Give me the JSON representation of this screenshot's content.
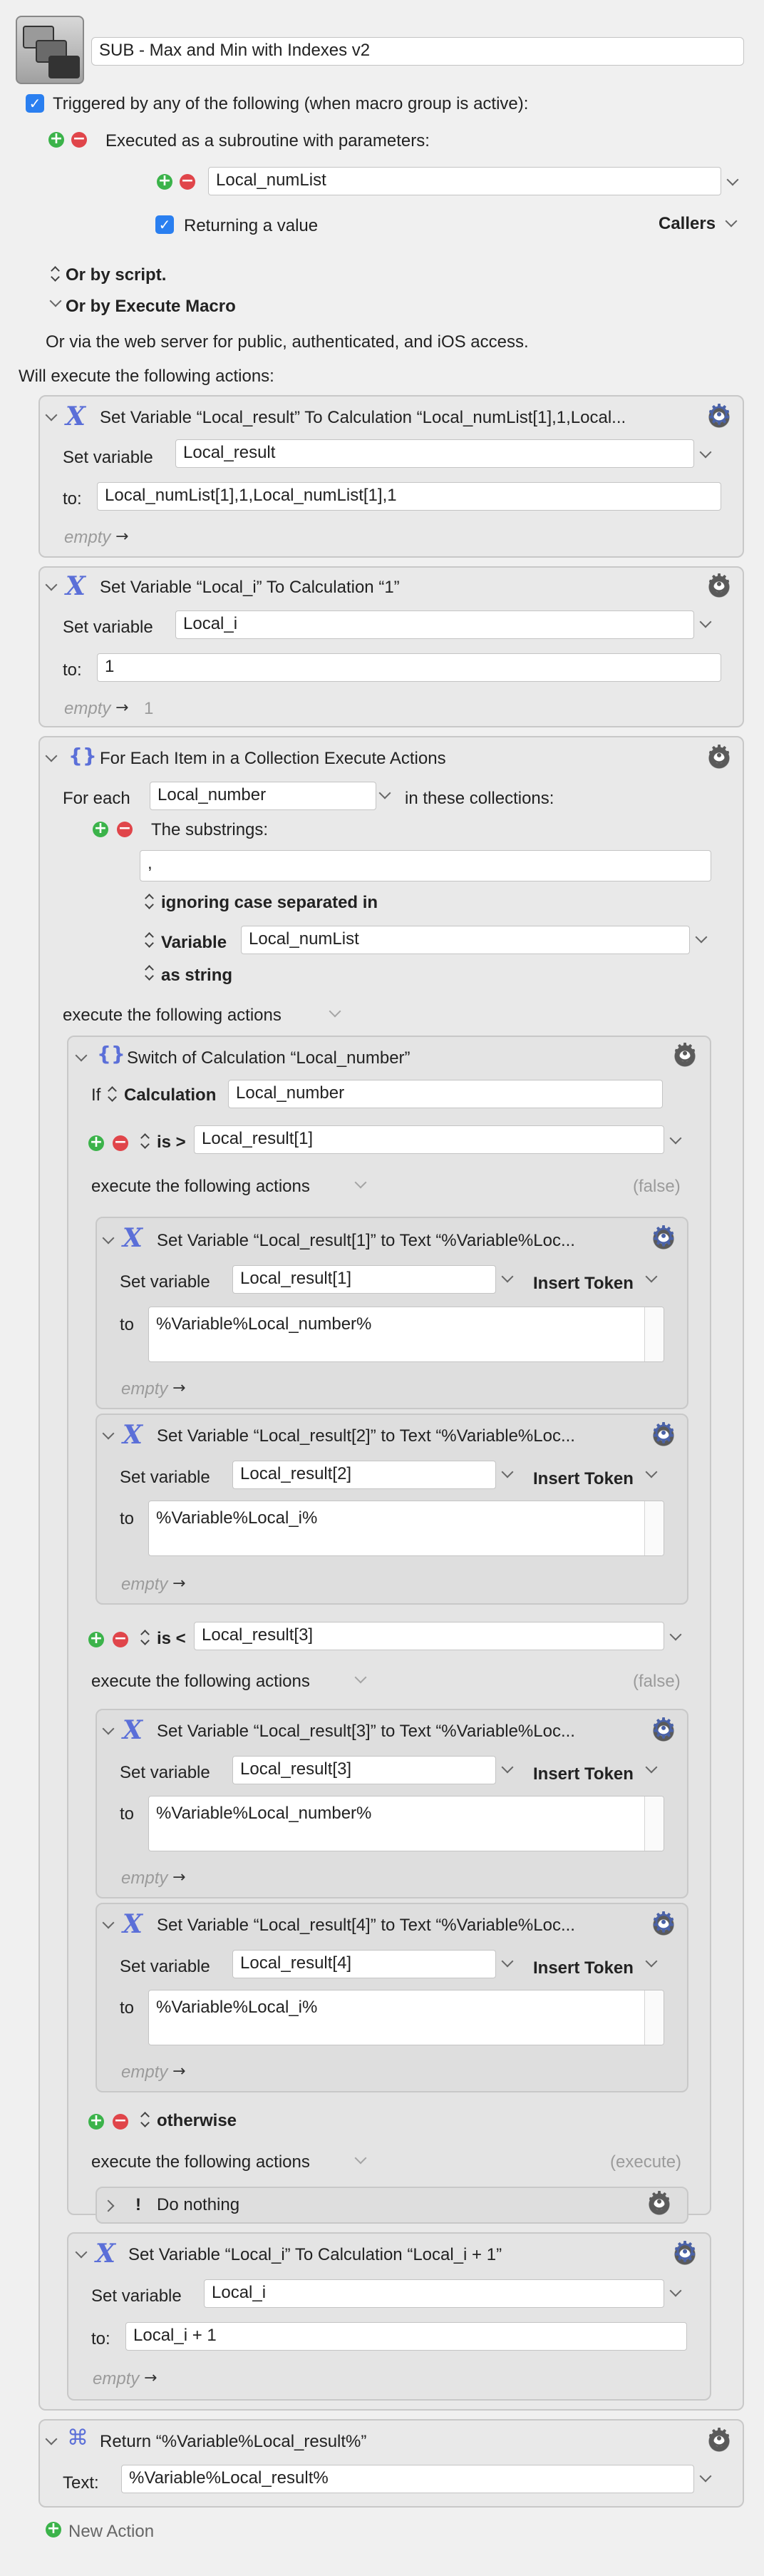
{
  "macro": {
    "name": "SUB - Max and Min with Indexes v2",
    "trigger_label": "Triggered by any of the following (when macro group is active):",
    "subroutine_label": "Executed as a subroutine with parameters:",
    "param_value": "Local_numList",
    "returning_label": "Returning a value",
    "callers_label": "Callers",
    "by_script": "Or by script.",
    "by_execute_macro": "Or by Execute Macro",
    "web_server": "Or via the web server for public, authenticated, and iOS access.",
    "will_execute": "Will execute the following actions:",
    "new_action": "New Action"
  },
  "a1": {
    "title": "Set Variable “Local_result” To Calculation “Local_numList[1],1,Local...",
    "set_label": "Set variable",
    "var": "Local_result",
    "to_label": "to:",
    "value": "Local_numList[1],1,Local_numList[1],1",
    "empty": "empty",
    "arrow": "→",
    "result": ""
  },
  "a2": {
    "title": "Set Variable “Local_i” To Calculation “1”",
    "set_label": "Set variable",
    "var": "Local_i",
    "to_label": "to:",
    "value": "1",
    "empty": "empty",
    "arrow": "→",
    "result": "1"
  },
  "foreach": {
    "title": "For Each Item in a Collection Execute Actions",
    "for_each": "For each",
    "var": "Local_number",
    "in_collections": "in these collections:",
    "substrings": "The substrings:",
    "separator": ",",
    "ignoring": "ignoring case separated in",
    "variable_label": "Variable",
    "variable_value": "Local_numList",
    "as_string": "as string",
    "execute_label": "execute the following actions"
  },
  "switch": {
    "title": "Switch of Calculation “Local_number”",
    "if_label": "If",
    "calc_label": "Calculation",
    "calc_value": "Local_number",
    "case1_op": "is >",
    "case1_value": "Local_result[1]",
    "case2_op": "is <",
    "case2_value": "Local_result[3]",
    "otherwise": "otherwise",
    "execute_label": "execute the following actions",
    "false_label": "(false)",
    "execute_tag": "(execute)"
  },
  "s1": {
    "title": "Set Variable “Local_result[1]” to Text “%Variable%Loc...",
    "var": "Local_result[1]",
    "text": "%Variable%Local_number%"
  },
  "s2": {
    "title": "Set Variable “Local_result[2]” to Text “%Variable%Loc...",
    "var": "Local_result[2]",
    "text": "%Variable%Local_i%"
  },
  "s3": {
    "title": "Set Variable “Local_result[3]” to Text “%Variable%Loc...",
    "var": "Local_result[3]",
    "text": "%Variable%Local_number%"
  },
  "s4": {
    "title": "Set Variable “Local_result[4]” to Text “%Variable%Loc...",
    "var": "Local_result[4]",
    "text": "%Variable%Local_i%"
  },
  "common": {
    "set_label": "Set variable",
    "to_label": "to",
    "insert_token": "Insert Token",
    "empty": "empty",
    "arrow": "→"
  },
  "do_nothing": {
    "label": "Do nothing",
    "bang": "!"
  },
  "a3": {
    "title": "Set Variable “Local_i” To Calculation “Local_i + 1”",
    "set_label": "Set variable",
    "var": "Local_i",
    "to_label": "to:",
    "value": "Local_i + 1",
    "empty": "empty",
    "arrow": "→"
  },
  "ret": {
    "title": "Return “%Variable%Local_result%”",
    "text_label": "Text:",
    "value": "%Variable%Local_result%"
  },
  "icons": [
    "app-icon",
    "checkbox-icon",
    "plus-icon",
    "minus-icon",
    "chevron-down-icon",
    "chevron-right-icon",
    "updown-icon",
    "gear-icon",
    "variable-x-icon",
    "braces-icon",
    "command-icon",
    "exclamation-icon"
  ],
  "colors": {
    "accent": "#5b6fd8",
    "plus": "#3bb34a",
    "minus": "#e0454a",
    "checkbox": "#2a7ff0"
  }
}
